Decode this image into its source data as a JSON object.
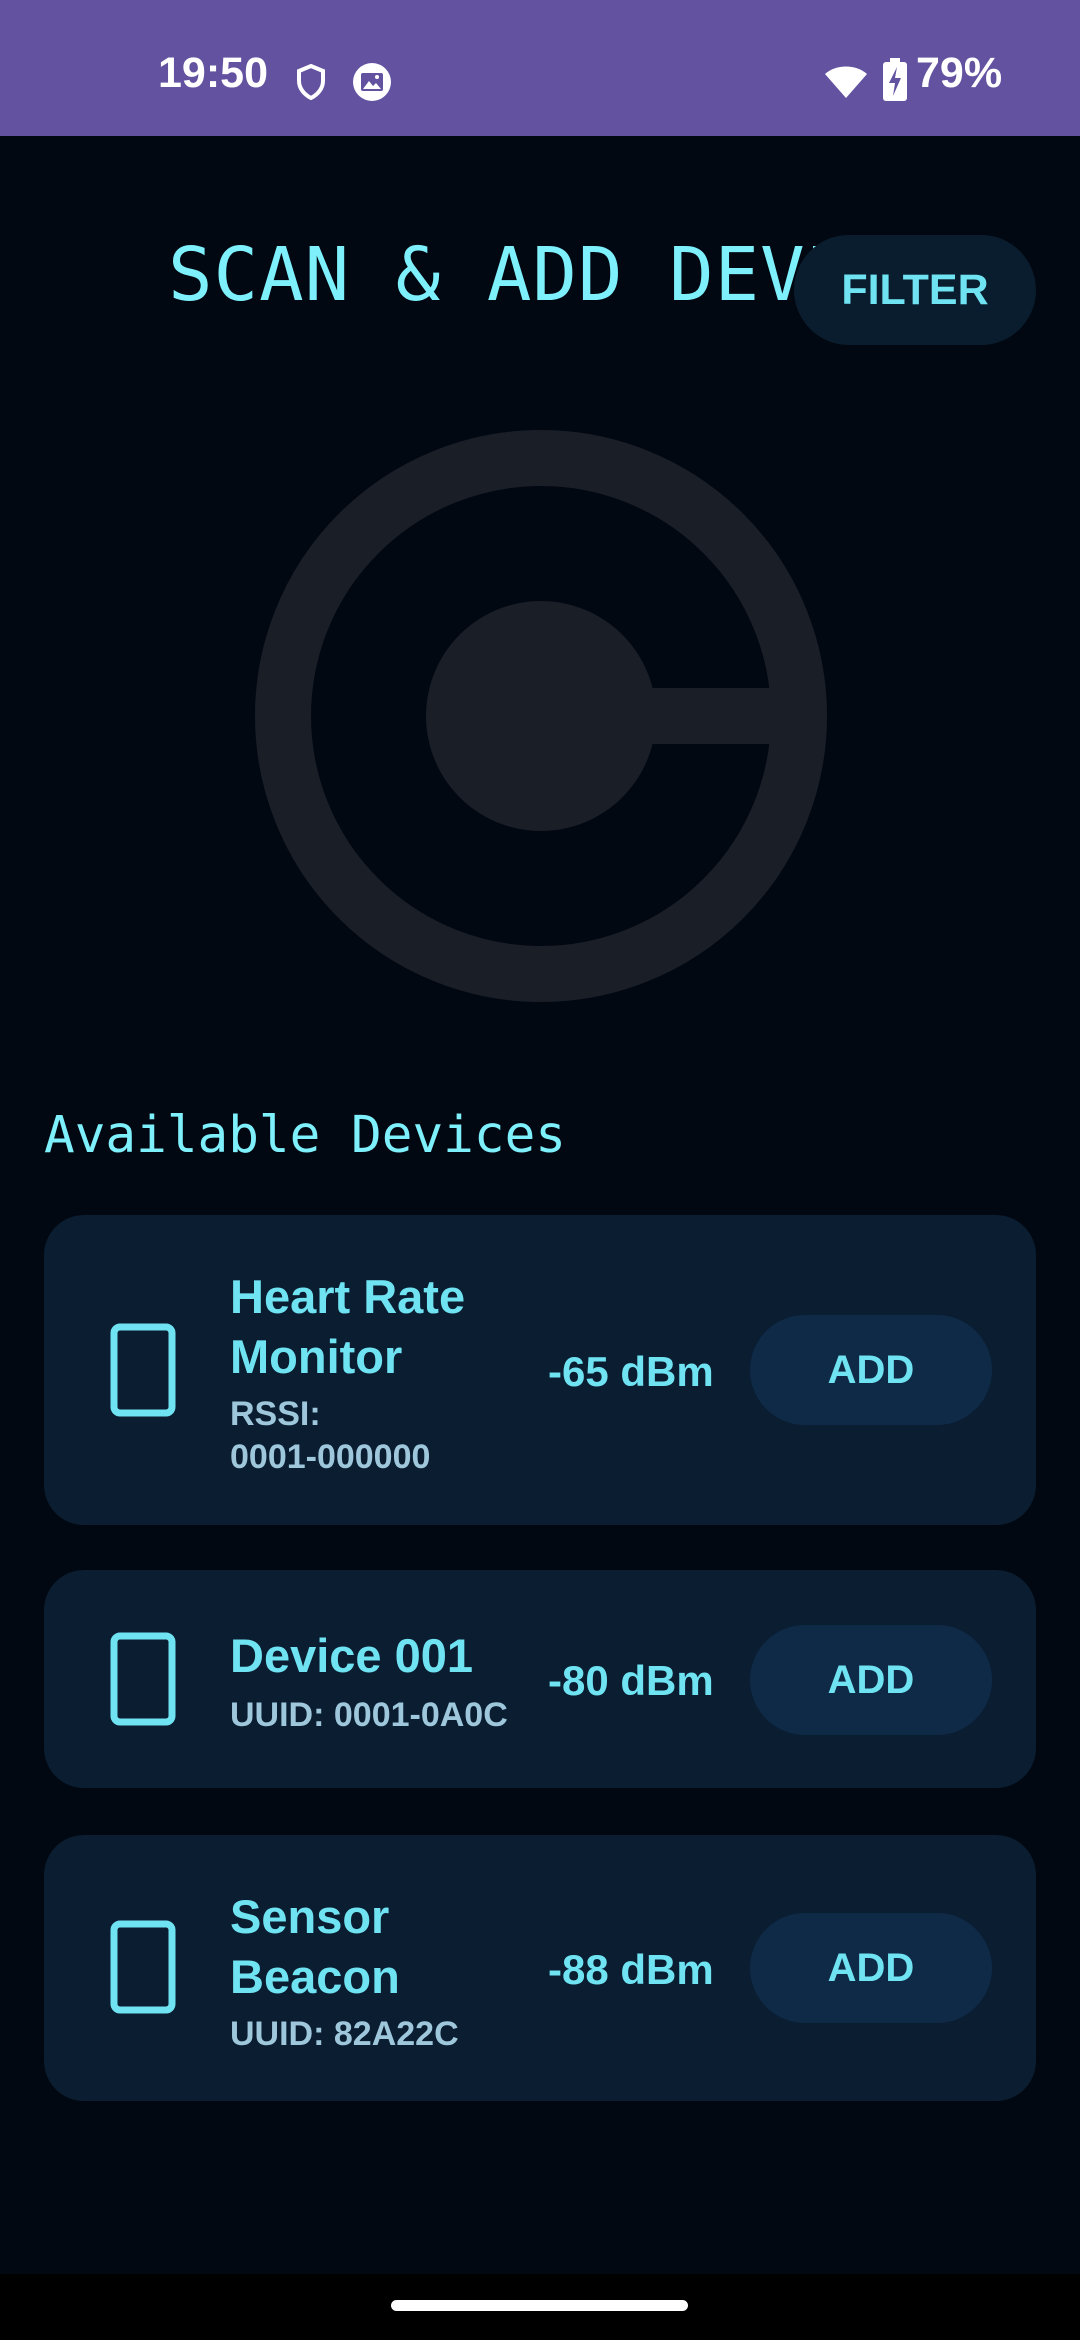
{
  "status_bar": {
    "time": "19:50",
    "battery_percent": "79%",
    "icons": [
      "shield-icon",
      "photo-notification-icon",
      "wifi-icon",
      "battery-charging-icon"
    ]
  },
  "header": {
    "title": "SCAN & ADD DEVI",
    "filter_label": "FILTER"
  },
  "scan_graphic": {
    "icon": "radar-scan-icon",
    "color": "#1a1e27"
  },
  "devices_section": {
    "title": "Available Devices",
    "devices": [
      {
        "name": "Heart Rate Monitor",
        "id_line1": "RSSI:",
        "id_line2": "0001-000000",
        "rssi": "-65 dBm",
        "add_label": "ADD",
        "icon": "phone-device-icon"
      },
      {
        "name": "Device 001",
        "id_line1": "UUID: 0001-0A0C",
        "rssi": "-80 dBm",
        "add_label": "ADD",
        "icon": "phone-device-icon"
      },
      {
        "name": "Sensor Beacon",
        "id_line1": "UUID: 82A22C",
        "rssi": "-88 dBm",
        "add_label": "ADD",
        "icon": "phone-device-icon"
      }
    ]
  },
  "colors": {
    "background": "#020812",
    "status_bar": "#6352a0",
    "accent": "#7ef0fb",
    "card": "#0a1d31",
    "button": "#0f2a47"
  }
}
